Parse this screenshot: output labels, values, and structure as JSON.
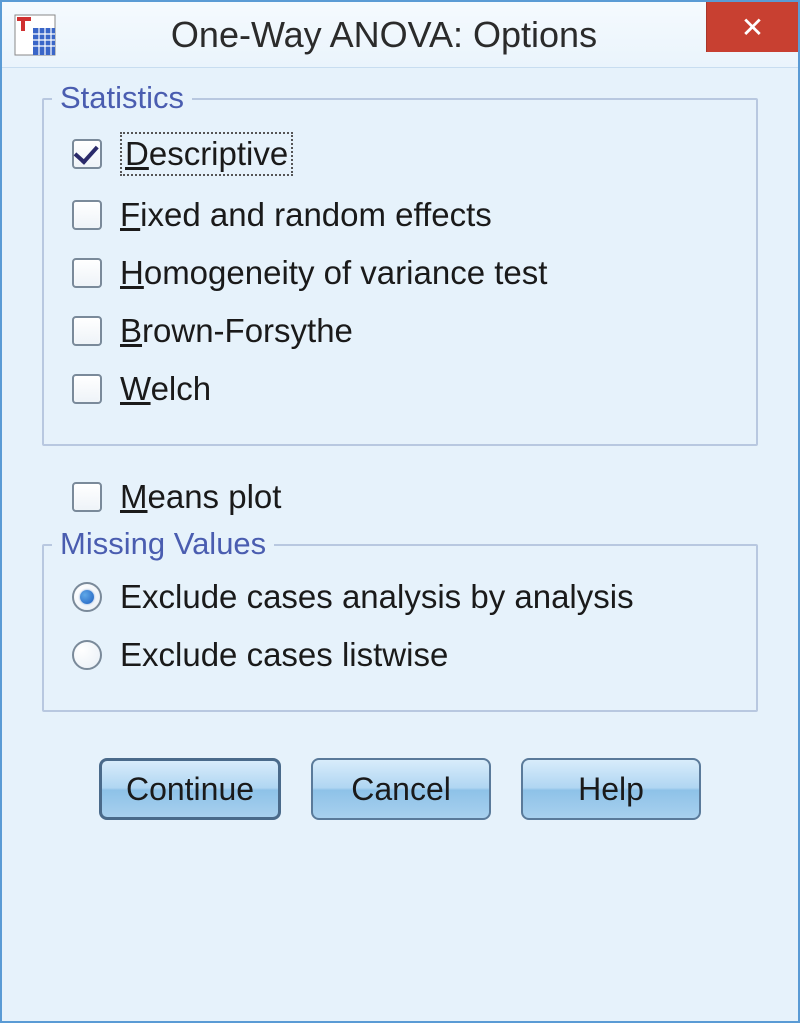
{
  "title": "One-Way ANOVA: Options",
  "groups": {
    "statistics": {
      "legend": "Statistics",
      "items": [
        {
          "label": "Descriptive",
          "mnemonic_index": 0,
          "checked": true,
          "focused": true
        },
        {
          "label": "Fixed and random effects",
          "mnemonic_index": 0,
          "checked": false,
          "focused": false
        },
        {
          "label": "Homogeneity of variance test",
          "mnemonic_index": 0,
          "checked": false,
          "focused": false
        },
        {
          "label": "Brown-Forsythe",
          "mnemonic_index": 0,
          "checked": false,
          "focused": false
        },
        {
          "label": "Welch",
          "mnemonic_index": 0,
          "checked": false,
          "focused": false
        }
      ]
    },
    "means_plot": {
      "label": "Means plot",
      "mnemonic_index": 0,
      "checked": false
    },
    "missing": {
      "legend": "Missing Values",
      "items": [
        {
          "label": "Exclude cases analysis by analysis",
          "mnemonic_index": -1,
          "selected": true
        },
        {
          "label": "Exclude cases listwise",
          "mnemonic_index": -1,
          "selected": false
        }
      ]
    }
  },
  "buttons": {
    "continue": "Continue",
    "cancel": "Cancel",
    "help": "Help"
  }
}
